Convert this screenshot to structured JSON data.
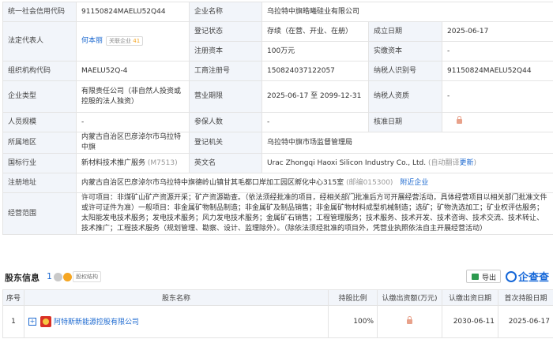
{
  "info": {
    "uscc_label": "统一社会信用代码",
    "uscc_value": "91150824MAELU52Q44",
    "company_name_label": "企业名称",
    "company_name_value": "乌拉特中旗皓曦硅业有限公司",
    "legal_rep_label": "法定代表人",
    "legal_rep_value": "何本丽",
    "legal_rep_badge_prefix": "关联企业",
    "legal_rep_badge_count": "41",
    "reg_status_label": "登记状态",
    "reg_status_value": "存续（在营、开业、在册）",
    "est_date_label": "成立日期",
    "est_date_value": "2025-06-17",
    "reg_capital_label": "注册资本",
    "reg_capital_value": "100万元",
    "paid_capital_label": "实缴资本",
    "paid_capital_value": "-",
    "org_code_label": "组织机构代码",
    "org_code_value": "MAELU52Q-4",
    "business_reg_label": "工商注册号",
    "business_reg_value": "150824037122057",
    "taxpayer_id_label": "纳税人识别号",
    "taxpayer_id_value": "91150824MAELU52Q44",
    "company_type_label": "企业类型",
    "company_type_value": "有限责任公司（非自然人投资或控股的法人独资）",
    "business_term_label": "营业期限",
    "business_term_value": "2025-06-17 至 2099-12-31",
    "taxpayer_qual_label": "纳税人资质",
    "taxpayer_qual_value": "-",
    "staff_size_label": "人员规模",
    "staff_size_value": "-",
    "insured_label": "参保人数",
    "insured_value": "-",
    "approval_date_label": "核准日期",
    "region_label": "所属地区",
    "region_value": "内蒙古自治区巴彦淖尔市乌拉特中旗",
    "authority_label": "登记机关",
    "authority_value": "乌拉特中旗市场监督管理局",
    "industry_label": "国标行业",
    "industry_value": "新材料技术推广服务",
    "industry_code": "(M7513)",
    "en_name_label": "英文名",
    "en_name_value": "Urac Zhongqi Haoxi Silicon Industry Co., Ltd.",
    "en_name_auto": "(自动翻译",
    "en_name_update": "更新",
    "en_name_close": ")",
    "address_label": "注册地址",
    "address_value": "内蒙古自治区巴彦淖尔市乌拉特中旗德岭山镇甘其毛都口岸加工园区孵化中心315室",
    "address_postal": "(邮编015300)",
    "address_nearby": "附近企业",
    "scope_label": "经营范围",
    "scope_value": "许可项目：非煤矿山矿产资源开采；矿产资源勘查。（依法须经批准的项目，经相关部门批准后方可开展经营活动，具体经营项目以相关部门批准文件或许可证件为准）一般项目：非金属矿物制品制造；非金属矿及制品销售；非金属矿物材料成型机械制造；选矿；矿物洗选加工；矿业权评估服务；太阳能发电技术服务；发电技术服务；风力发电技术服务；金属矿石销售；工程管理服务；技术服务、技术开发、技术咨询、技术交流、技术转让、技术推广；工程技术服务（规划管理、勘察、设计、监理除外）。（除依法须经批准的项目外，凭营业执照依法自主开展经营活动）"
  },
  "shareholders": {
    "title": "股东信息",
    "count": "1",
    "tag": "股权结构",
    "export_label": "导出",
    "brand": "企查查",
    "columns": [
      "序号",
      "股东名称",
      "持股比例",
      "认缴出资额(万元)",
      "认缴出资日期",
      "首次持股日期"
    ],
    "rows": [
      {
        "index": "1",
        "plus": "+",
        "name": "阿特斯新能源控股有限公司",
        "ratio": "100%",
        "date": "2030-06-11",
        "first_date": "2025-06-17"
      }
    ]
  },
  "colors": {
    "link": "#1e6ad0",
    "label_bg": "#f2f5fa",
    "border": "#e4e4e4"
  }
}
